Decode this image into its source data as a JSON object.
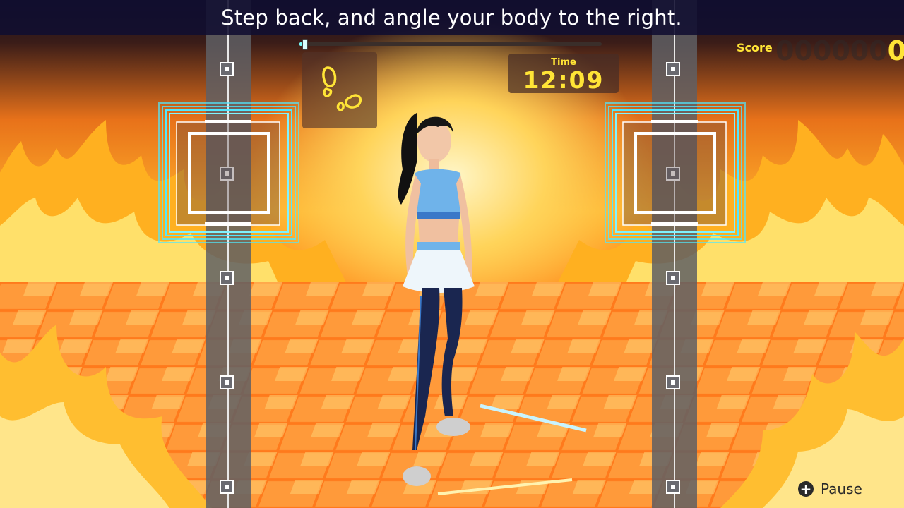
{
  "instruction": {
    "text": "Step back, and angle your body to the right."
  },
  "progress": {
    "fraction": 0.01
  },
  "step_hint": {
    "icon": "footprints-icon"
  },
  "timer": {
    "label": "Time",
    "value": "12:09"
  },
  "score": {
    "label": "Score",
    "dim_digits": "000000",
    "lit_digit": "0"
  },
  "pause": {
    "icon": "plus-icon",
    "label": "Pause"
  },
  "colors": {
    "accent_yellow": "#ffe436",
    "target_cyan": "#4fe7ff",
    "banner_bg": "#100e30"
  }
}
